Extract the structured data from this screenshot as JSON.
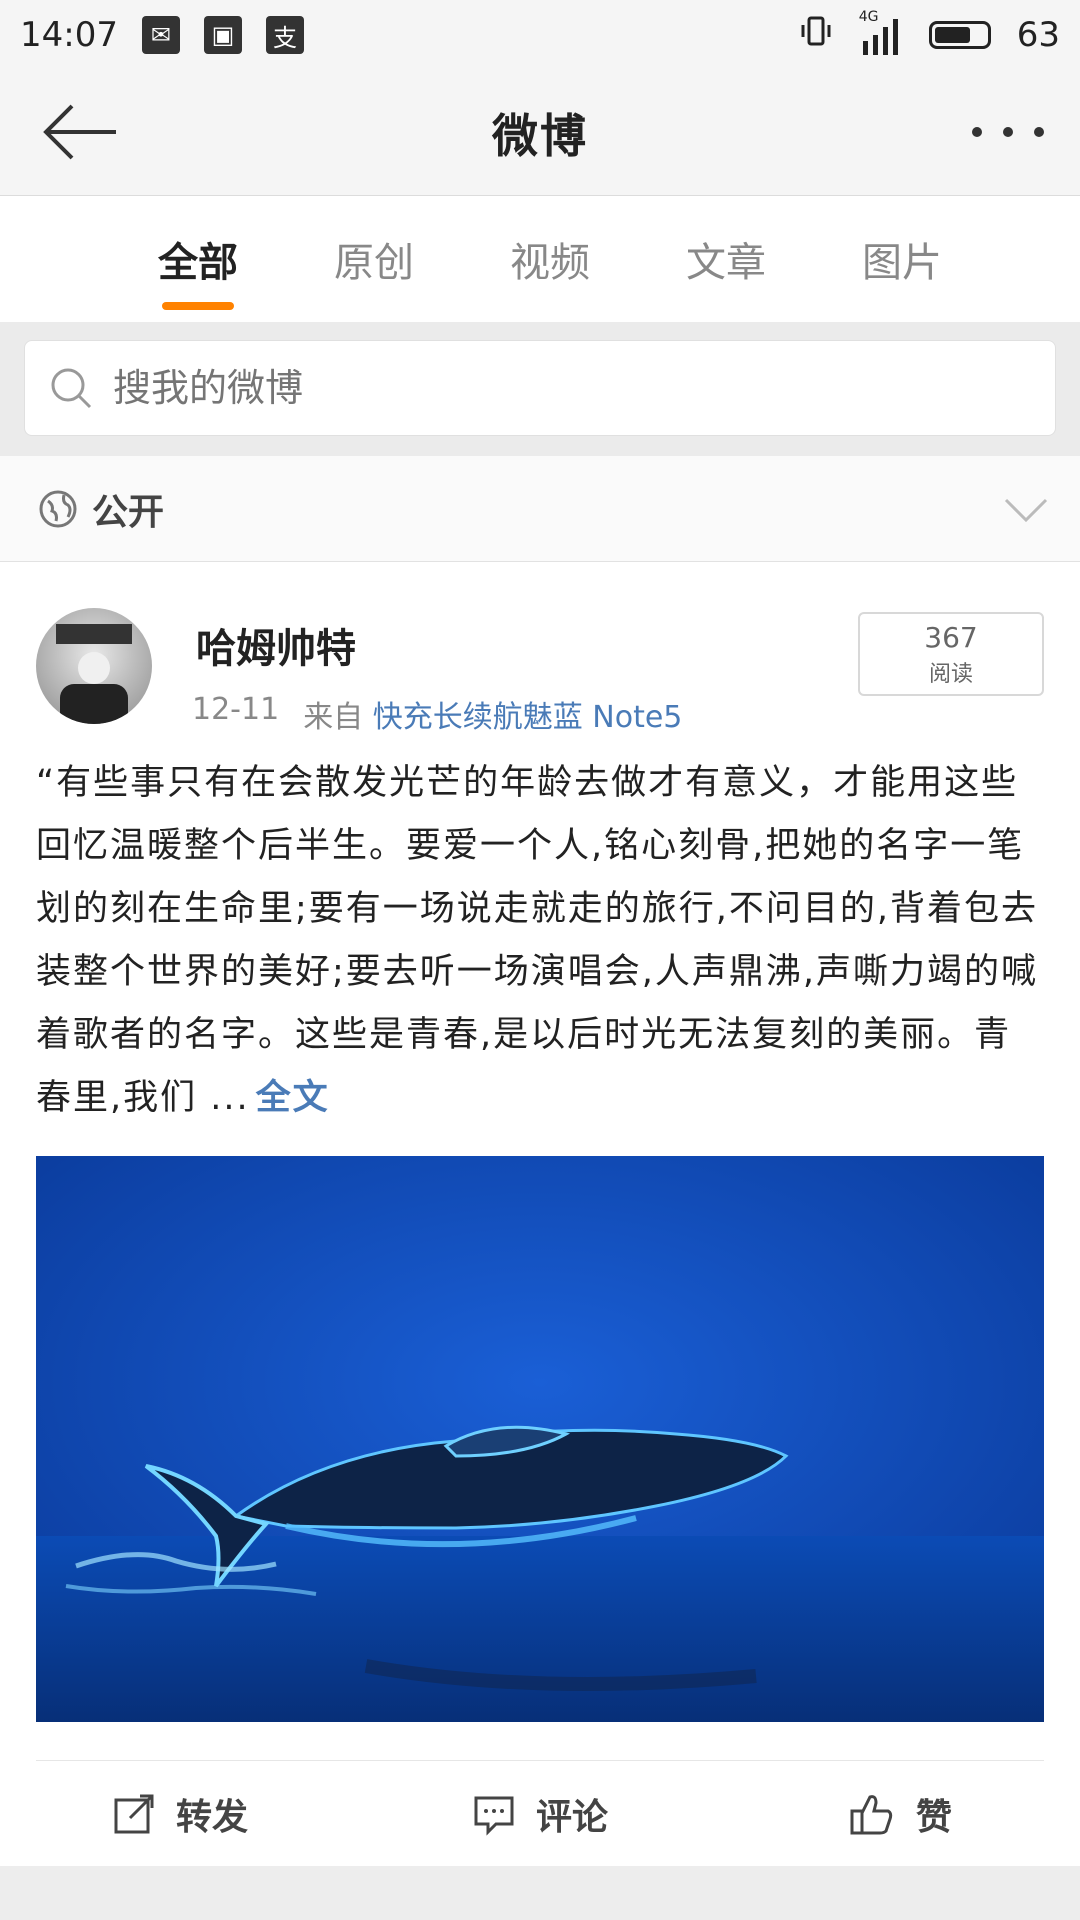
{
  "status_bar": {
    "time": "14:07",
    "notification_icons": [
      "mail-icon",
      "image-icon",
      "alipay-icon"
    ],
    "network": "4G",
    "battery_level": "63"
  },
  "header": {
    "title": "微博",
    "back_icon": "back-arrow-icon",
    "more_icon": "more-icon"
  },
  "tabs": [
    {
      "label": "全部",
      "active": true
    },
    {
      "label": "原创",
      "active": false
    },
    {
      "label": "视频",
      "active": false
    },
    {
      "label": "文章",
      "active": false
    },
    {
      "label": "图片",
      "active": false
    }
  ],
  "search": {
    "placeholder": "搜我的微博"
  },
  "visibility": {
    "label": "公开"
  },
  "post": {
    "username": "哈姆帅特",
    "date": "12-11",
    "source_prefix": "来自",
    "source": "快充长续航魅蓝 Note5",
    "read_count": "367",
    "read_label": "阅读",
    "text": "“有些事只有在会散发光芒的年龄去做才有意义，才能用这些回忆温暖整个后半生。要爱一个人,铭心刻骨,把她的名字一笔划的刻在生命里;要有一场说走就走的旅行,不问目的,背着包去装整个世界的美好;要去听一场演唱会,人声鼎沸,声嘶力竭的喊着歌者的名字。这些是青春,是以后时光无法复刻的美丽。青春里,我们 ...",
    "full_text_link": "全文",
    "actions": {
      "repost": "转发",
      "comment": "评论",
      "like": "赞"
    }
  },
  "colors": {
    "accent": "#ff8200",
    "link": "#4a7bb7",
    "image_ocean": "#0a47b8"
  }
}
